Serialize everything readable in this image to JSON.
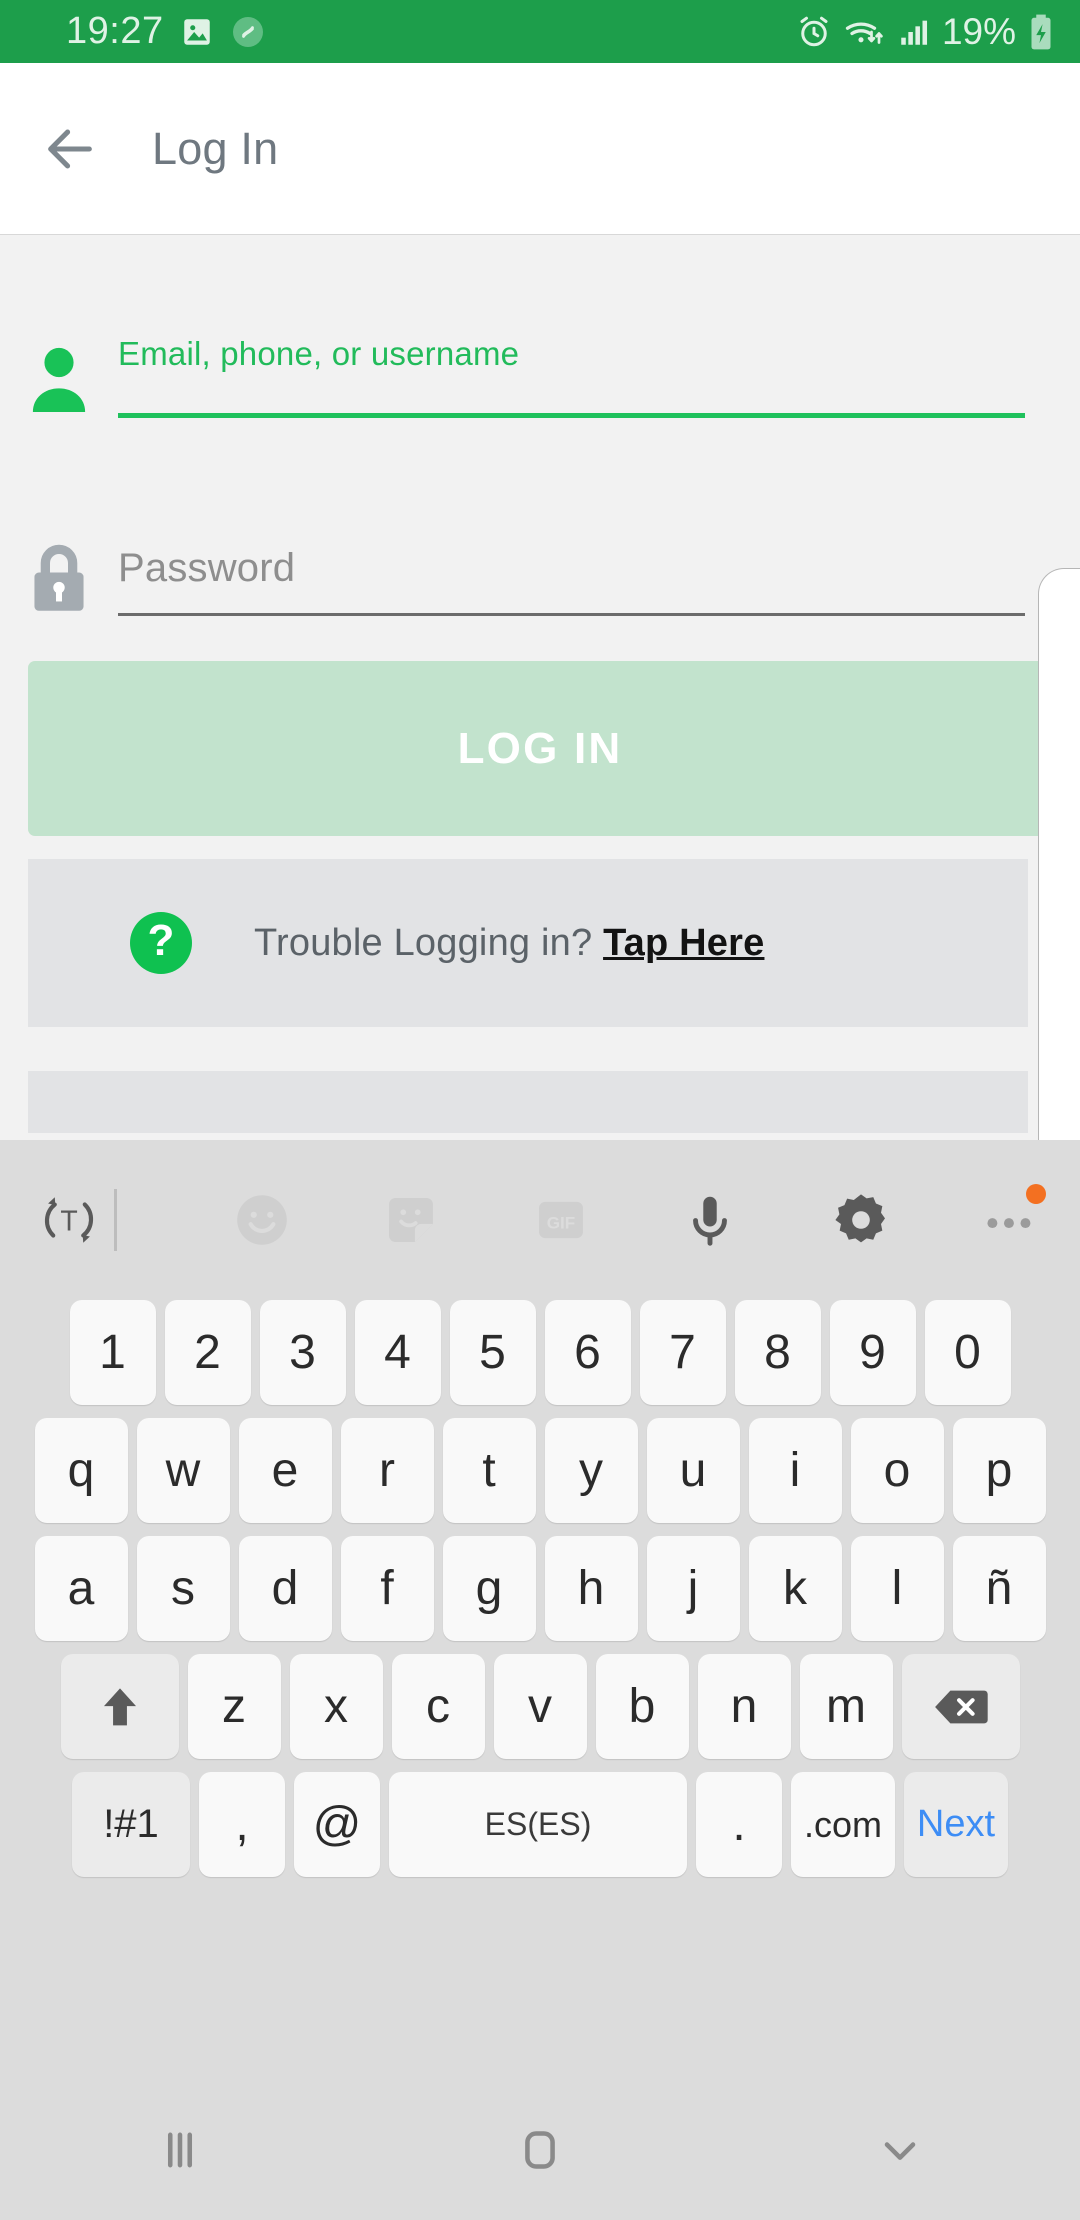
{
  "status_bar": {
    "time": "19:27",
    "battery_percent": "19%",
    "icons": [
      "gallery-icon",
      "shazam-icon",
      "alarm-icon",
      "wifi-icon",
      "cellular-signal-icon",
      "battery-charging-icon"
    ],
    "background_color": "#1d9e4b",
    "text_color": "#dff2e5"
  },
  "app_bar": {
    "back_label": "back-arrow",
    "title": "Log In"
  },
  "form": {
    "username": {
      "label": "Email, phone, or username",
      "value": "",
      "icon": "person-icon",
      "accent_color": "#1fc15c"
    },
    "password": {
      "placeholder": "Password",
      "value": "",
      "icon": "lock-icon",
      "line_color": "#6c6c6c"
    },
    "login_button": {
      "label": "LOG IN",
      "background": "#c2e3cd",
      "text_color": "#ffffff",
      "disabled": true
    },
    "trouble": {
      "icon": "question-mark-icon",
      "text": "Trouble Logging in? ",
      "link": "Tap Here"
    }
  },
  "keyboard": {
    "toolbar": [
      "translate-icon",
      "emoji-icon",
      "sticker-icon",
      "gif-icon",
      "microphone-icon",
      "settings-gear-icon",
      "more-options-icon"
    ],
    "row_numbers": [
      "1",
      "2",
      "3",
      "4",
      "5",
      "6",
      "7",
      "8",
      "9",
      "0"
    ],
    "row_top": [
      "q",
      "w",
      "e",
      "r",
      "t",
      "y",
      "u",
      "i",
      "o",
      "p"
    ],
    "row_home": [
      "a",
      "s",
      "d",
      "f",
      "g",
      "h",
      "j",
      "k",
      "l",
      "ñ"
    ],
    "row_bottom": [
      "z",
      "x",
      "c",
      "v",
      "b",
      "n",
      "m"
    ],
    "shift_label": "shift-icon",
    "backspace_label": "backspace-icon",
    "symbols_key": "!#1",
    "comma_key": ",",
    "at_key": "@",
    "space_key": "ES(ES)",
    "period_key": ".",
    "dotcom_key": ".com",
    "next_key": "Next",
    "next_color": "#3d8df5"
  },
  "nav_bar": {
    "recents": "recents-icon",
    "home": "home-icon",
    "dismiss": "hide-keyboard-chevron-icon"
  }
}
